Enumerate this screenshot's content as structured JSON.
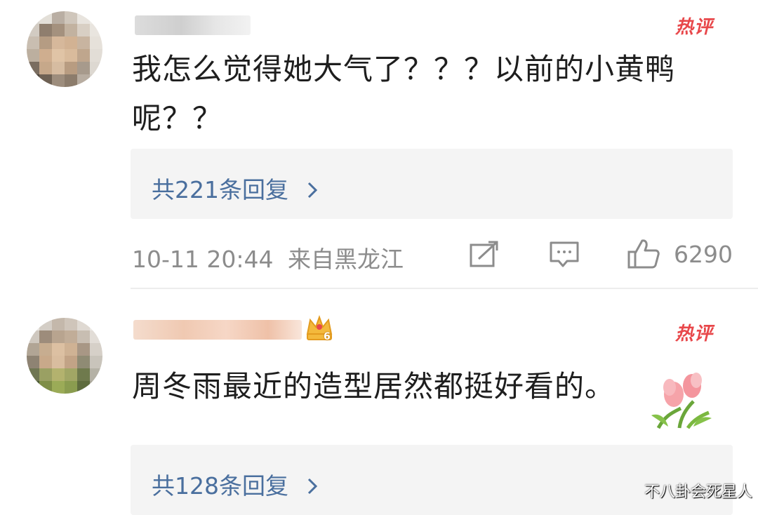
{
  "comments": [
    {
      "hot_badge": "热评",
      "text_line1": "我怎么觉得她大气了？？？以前的小黄鸭",
      "text_line2": "呢？？",
      "replies_label": "共221条回复",
      "timestamp": "10-11 20:44",
      "location": "来自黑龙江",
      "likes": "6290"
    },
    {
      "hot_badge": "热评",
      "text_line1": "周冬雨最近的造型居然都挺好看的。",
      "replies_label": "共128条回复",
      "level_badge": "6"
    }
  ],
  "icons": {
    "share": "share-icon",
    "comment": "comment-icon",
    "like": "thumbs-up-icon",
    "chevron": "chevron-right-icon",
    "tulip": "tulip-sticker-icon",
    "crown": "vip-crown-icon"
  },
  "colors": {
    "hot_badge": "#e8474a",
    "reply_link": "#4a6f9e",
    "meta_text": "#8c8c8c",
    "reply_bg": "#f4f4f4"
  },
  "watermark": "不八卦会死星人"
}
